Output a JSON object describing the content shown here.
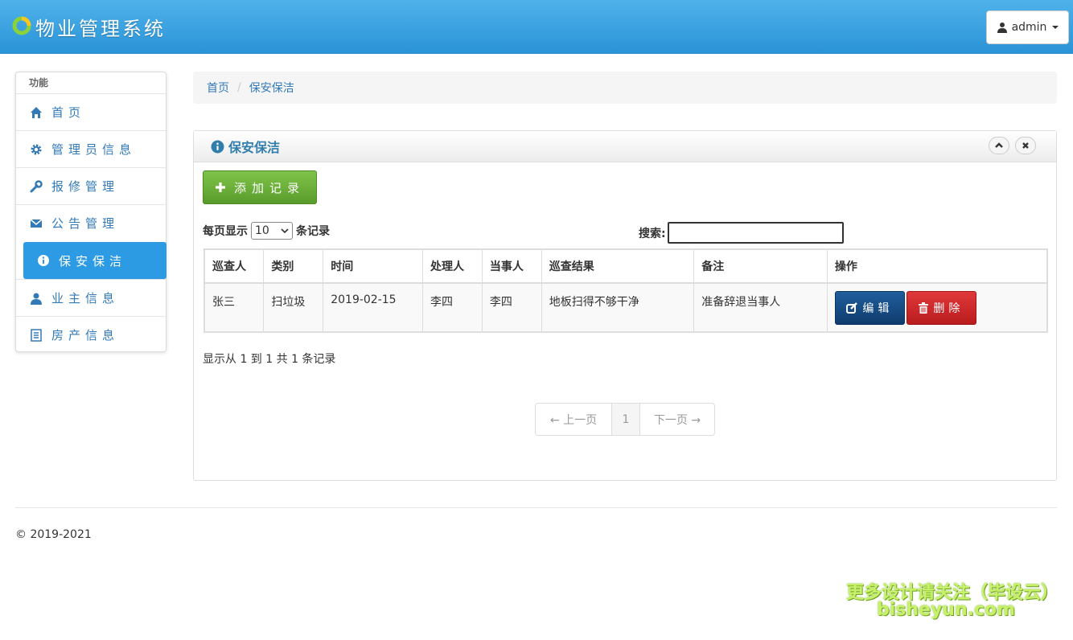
{
  "header": {
    "app_title": "物业管理系统",
    "user_label": "admin"
  },
  "sidebar": {
    "title": "功能",
    "items": [
      {
        "label": "首页",
        "icon": "home-icon"
      },
      {
        "label": "管理员信息",
        "icon": "gear-icon"
      },
      {
        "label": "报修管理",
        "icon": "wrench-icon"
      },
      {
        "label": "公告管理",
        "icon": "envelope-icon"
      },
      {
        "label": "保安保洁",
        "icon": "info-icon",
        "active": true
      },
      {
        "label": "业主信息",
        "icon": "user-icon"
      },
      {
        "label": "房产信息",
        "icon": "list-icon"
      }
    ]
  },
  "breadcrumb": {
    "home": "首页",
    "separator": "/",
    "current": "保安保洁"
  },
  "panel": {
    "title": "保安保洁",
    "add_label": "添加记录",
    "length_prefix": "每页显示",
    "length_value": "10",
    "length_suffix": "条记录",
    "search_label": "搜索:",
    "columns": [
      "巡查人",
      "类别",
      "时间",
      "处理人",
      "当事人",
      "巡查结果",
      "备注",
      "操作"
    ],
    "rows": [
      [
        "张三",
        "扫垃圾",
        "2019-02-15",
        "李四",
        "李四",
        "地板扫得不够干净",
        "准备辞退当事人"
      ]
    ],
    "edit_label": "编辑",
    "delete_label": "删除",
    "info": "显示从 1 到 1 共 1 条记录",
    "pager": {
      "prev": "← 上一页",
      "current": "1",
      "next": "下一页 →"
    }
  },
  "footer": {
    "copyright": "© 2019-2021"
  },
  "watermark": {
    "line1": "更多设计请关注（毕设云）",
    "line2": "bisheyun.com"
  },
  "colors": {
    "header": "#2a93d7",
    "active": "#2d9be4",
    "link": "#337ab7",
    "add": "#6aae38",
    "edit": "#134a82",
    "delete": "#d02628"
  }
}
